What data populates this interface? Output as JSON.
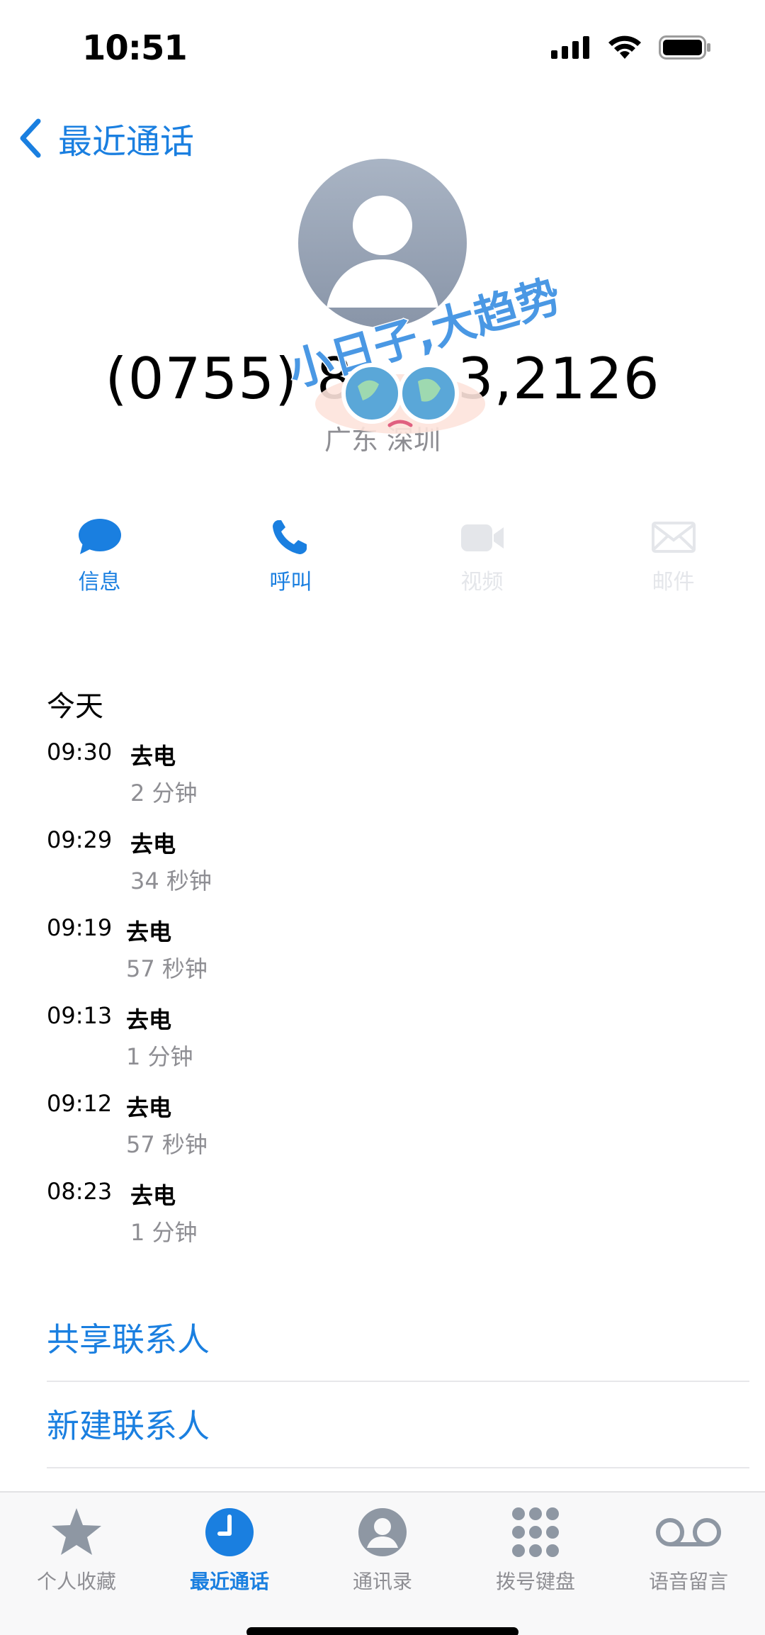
{
  "status_bar": {
    "time": "10:51",
    "icons": [
      "signal-icon",
      "wifi-icon",
      "battery-icon"
    ]
  },
  "nav": {
    "back_label": "最近通话"
  },
  "contact": {
    "phone_number": "(0755) 8       3,2126",
    "location": "广东 深圳"
  },
  "watermark": {
    "text": "小日子,大趋势"
  },
  "actions": [
    {
      "label": "信息",
      "icon": "message-bubble-icon",
      "enabled": true
    },
    {
      "label": "呼叫",
      "icon": "phone-icon",
      "enabled": true
    },
    {
      "label": "视频",
      "icon": "video-camera-icon",
      "enabled": false
    },
    {
      "label": "邮件",
      "icon": "mail-icon",
      "enabled": false
    }
  ],
  "history": {
    "header": "今天",
    "calls": [
      {
        "time": "09:30",
        "type": "去电",
        "duration": "2 分钟"
      },
      {
        "time": "09:29",
        "type": "去电",
        "duration": "34 秒钟"
      },
      {
        "time": "09:19",
        "type": "去电",
        "duration": "57 秒钟"
      },
      {
        "time": "09:13",
        "type": "去电",
        "duration": "1 分钟"
      },
      {
        "time": "09:12",
        "type": "去电",
        "duration": "57 秒钟"
      },
      {
        "time": "08:23",
        "type": "去电",
        "duration": "1 分钟"
      }
    ]
  },
  "contact_actions": {
    "share_label": "共享联系人",
    "new_label": "新建联系人"
  },
  "tabbar": {
    "tabs": [
      {
        "label": "个人收藏",
        "icon": "star-icon",
        "active": false
      },
      {
        "label": "最近通话",
        "icon": "clock-icon",
        "active": true
      },
      {
        "label": "通讯录",
        "icon": "person-circle-icon",
        "active": false
      },
      {
        "label": "拨号键盘",
        "icon": "keypad-icon",
        "active": false
      },
      {
        "label": "语音留言",
        "icon": "voicemail-icon",
        "active": false
      }
    ]
  },
  "colors": {
    "accent": "#1a7fe0",
    "secondary_text": "#8e8e93",
    "disabled": "#e4e6ea",
    "inactive_icon": "#8e97a3"
  }
}
